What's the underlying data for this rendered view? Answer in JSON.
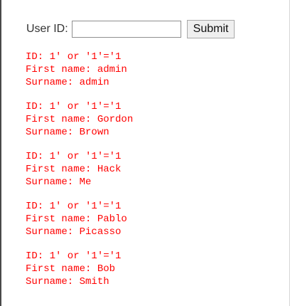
{
  "form": {
    "label": "User ID:",
    "input_value": "",
    "submit_label": "Submit"
  },
  "results": [
    {
      "id_line": "ID: 1' or '1'='1",
      "first_line": "First name: admin",
      "surname_line": "Surname: admin"
    },
    {
      "id_line": "ID: 1' or '1'='1",
      "first_line": "First name: Gordon",
      "surname_line": "Surname: Brown"
    },
    {
      "id_line": "ID: 1' or '1'='1",
      "first_line": "First name: Hack",
      "surname_line": "Surname: Me"
    },
    {
      "id_line": "ID: 1' or '1'='1",
      "first_line": "First name: Pablo",
      "surname_line": "Surname: Picasso"
    },
    {
      "id_line": "ID: 1' or '1'='1",
      "first_line": "First name: Bob",
      "surname_line": "Surname: Smith"
    }
  ],
  "colors": {
    "result_text": "#ff0000",
    "label_text": "#333333"
  }
}
